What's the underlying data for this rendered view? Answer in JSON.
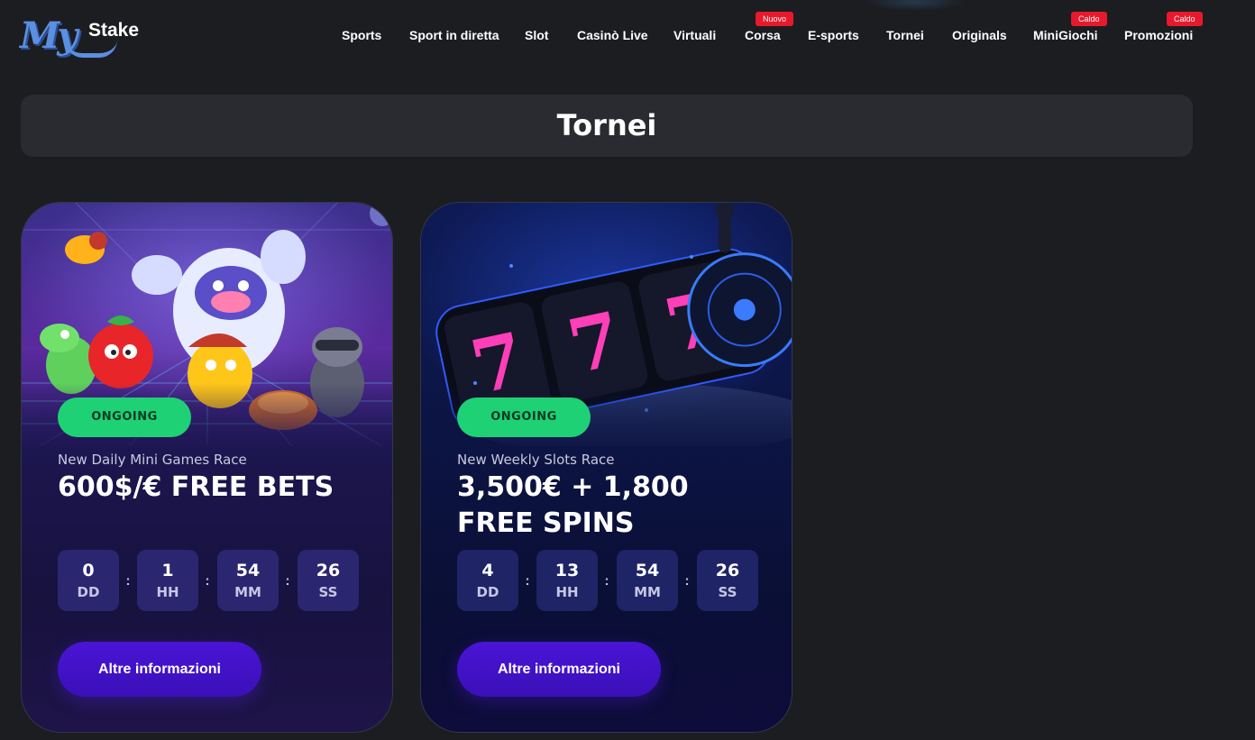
{
  "brand": {
    "logo_my": "My",
    "logo_stake": "Stake"
  },
  "nav": {
    "items": [
      {
        "label": "Sports"
      },
      {
        "label": "Sport in diretta"
      },
      {
        "label": "Slot"
      },
      {
        "label": "Casinò Live"
      },
      {
        "label": "Virtuali"
      },
      {
        "label": "Corsa",
        "badge": "Nuovo"
      },
      {
        "label": "E-sports"
      },
      {
        "label": "Tornei"
      },
      {
        "label": "Originals"
      },
      {
        "label": "MiniGiochi",
        "badge": "Caldo"
      },
      {
        "label": "Promozioni",
        "badge": "Caldo"
      }
    ],
    "badge_color": "#e8192c"
  },
  "page": {
    "title": "Tornei"
  },
  "tournaments": [
    {
      "status": "ONGOING",
      "subtitle": "New Daily Mini Games Race",
      "headline": "600$/€ FREE BETS",
      "countdown": [
        {
          "value": "0",
          "unit": "DD"
        },
        {
          "value": "1",
          "unit": "HH"
        },
        {
          "value": "54",
          "unit": "MM"
        },
        {
          "value": "26",
          "unit": "SS"
        }
      ],
      "button_label": "Altre informazioni",
      "art_icon": "mini-games-characters-art"
    },
    {
      "status": "ONGOING",
      "subtitle": "New Weekly Slots Race",
      "headline": "3,500€ + 1,800 FREE SPINS",
      "countdown": [
        {
          "value": "4",
          "unit": "DD"
        },
        {
          "value": "13",
          "unit": "HH"
        },
        {
          "value": "54",
          "unit": "MM"
        },
        {
          "value": "26",
          "unit": "SS"
        }
      ],
      "button_label": "Altre informazioni",
      "art_icon": "slot-machine-777-art"
    }
  ],
  "colors": {
    "background": "#1c1d21",
    "title_bar": "#2a2b31",
    "status_green": "#1ed175",
    "button_purple": "#4a14d6",
    "slot_seven_pink": "#ff3fb8"
  }
}
